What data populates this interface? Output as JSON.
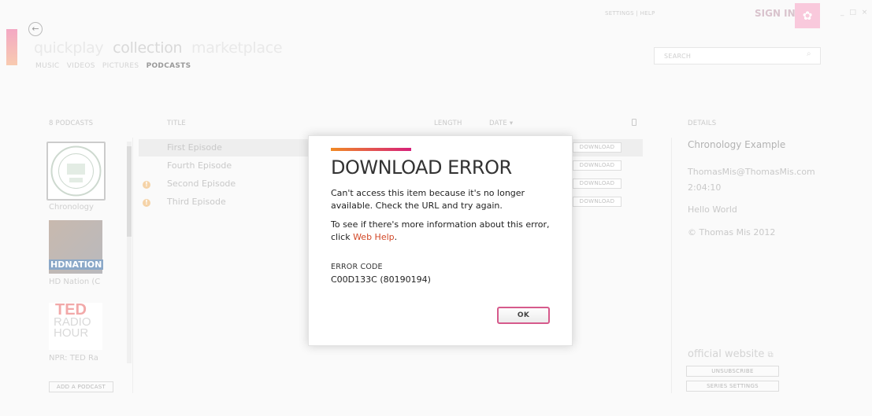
{
  "header": {
    "back_glyph": "←",
    "pivots": [
      "quickplay",
      "collection",
      "marketplace"
    ],
    "subnav": [
      "MUSIC",
      "VIDEOS",
      "PICTURES",
      "PODCASTS"
    ],
    "settings": "SETTINGS",
    "separator": "|",
    "help": "HELP",
    "sign_in": "SIGN IN",
    "window_controls": "_ □ ×",
    "search_placeholder": "SEARCH"
  },
  "podcasts": {
    "count_label": "8 PODCASTS",
    "items": [
      {
        "label": "Chronology",
        "thumb": "csu-seal-image"
      },
      {
        "label": "HD Nation (C",
        "thumb": "hd-nation-image"
      },
      {
        "label": "NPR: TED Ra",
        "thumb": "ted-radio-hour-image"
      }
    ],
    "thumb_text": {
      "hd_badge": "HDNATION",
      "ted_top": "TED",
      "ted_mid": "RADIO",
      "ted_bot": "HOUR"
    },
    "add_button": "ADD A PODCAST"
  },
  "episodes": {
    "headers": {
      "title": "TITLE",
      "length": "LENGTH",
      "date": "DATE ▾"
    },
    "rows": [
      {
        "title": "First Episode",
        "action": "DOWNLOAD",
        "warning": false
      },
      {
        "title": "Fourth Episode",
        "action": "DOWNLOAD",
        "warning": false
      },
      {
        "title": "Second Episode",
        "action": "DOWNLOAD",
        "warning": true
      },
      {
        "title": "Third Episode",
        "action": "DOWNLOAD",
        "warning": true
      }
    ]
  },
  "details": {
    "header": "DETAILS",
    "title": "Chronology Example",
    "email": "ThomasMis@ThomasMis.com",
    "duration": "2:04:10",
    "description": "Hello World",
    "copyright": "© Thomas Mis 2012",
    "official_website": "official website",
    "unsubscribe": "UNSUBSCRIBE",
    "series_settings": "SERIES SETTINGS"
  },
  "dialog": {
    "title": "DOWNLOAD ERROR",
    "message1": "Can't access this item because it's no longer available. Check the URL and try again.",
    "message2_prefix": "To see if there's more information about this error, click ",
    "message2_link": "Web Help",
    "message2_suffix": ".",
    "error_code_label": "ERROR CODE",
    "error_code": "C00D133C (80190194)",
    "ok": "OK",
    "accent_from": "#f08a24",
    "accent_to": "#d6207a"
  }
}
